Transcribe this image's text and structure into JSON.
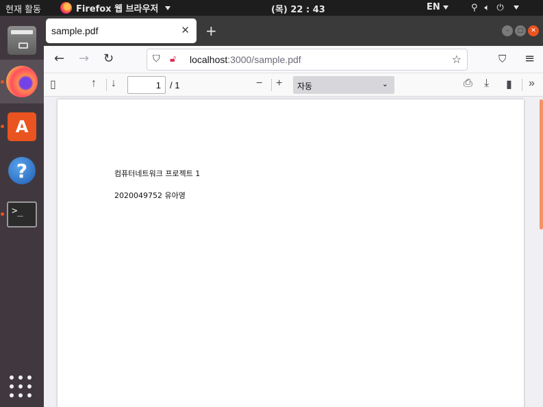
{
  "topbar": {
    "activities": "현재 활동",
    "app_menu": "Firefox 웹 브라우저",
    "clock": "(목) 22 : 43",
    "lang": "EN"
  },
  "dock": {
    "items": [
      "files-icon",
      "firefox-icon",
      "software-store-icon",
      "help-icon",
      "terminal-icon"
    ],
    "store_glyph": "A",
    "help_glyph": "?",
    "terminal_prompt": ">_"
  },
  "browser": {
    "tab_title": "sample.pdf",
    "url_host": "localhost",
    "url_rest": ":3000/sample.pdf"
  },
  "pdf_toolbar": {
    "page_number": "1",
    "page_total": "/ 1",
    "zoom_value": "자동"
  },
  "document": {
    "line1": "컴퓨터네트워크 프로젝트 1",
    "line2": "2020049752 유아영"
  },
  "colors": {
    "accent": "#e95420",
    "dock_bg": "#41383f",
    "topbar_bg": "#1d1d1d"
  }
}
